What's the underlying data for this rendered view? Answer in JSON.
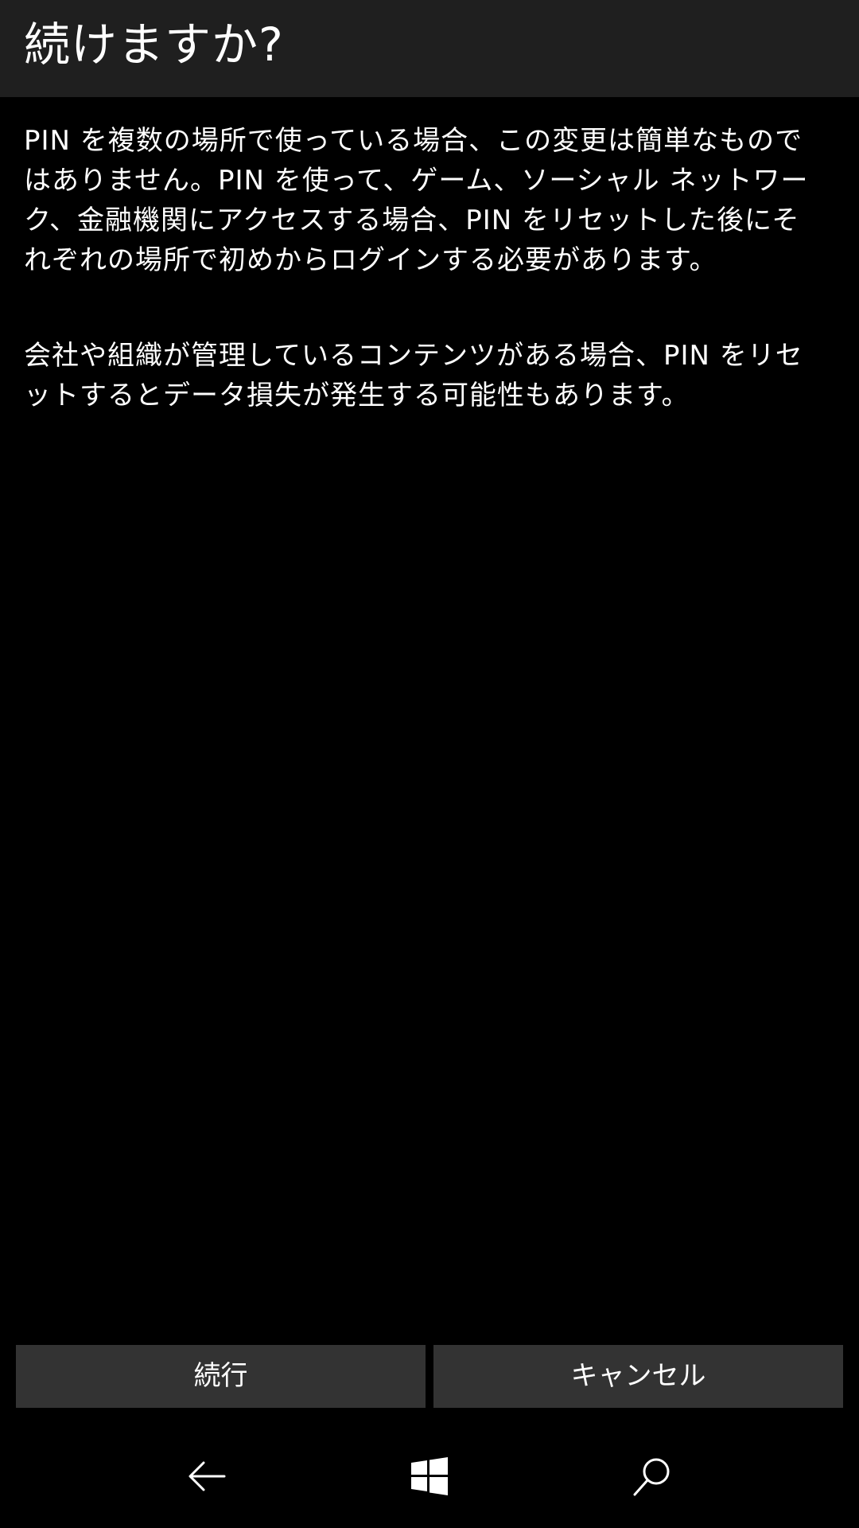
{
  "dialog": {
    "title": "続けますか?",
    "paragraphs": [
      "PIN を複数の場所で使っている場合、この変更は簡単なものではありません。PIN を使って、ゲーム、ソーシャル ネットワーク、金融機関にアクセスする場合、PIN をリセットした後にそれぞれの場所で初めからログインする必要があります。",
      "会社や組織が管理しているコンテンツがある場合、PIN をリセットするとデータ損失が発生する可能性もあります。"
    ],
    "continue_label": "続行",
    "cancel_label": "キャンセル"
  },
  "navbar": {
    "icons": [
      "back-arrow-icon",
      "windows-logo-icon",
      "search-icon"
    ]
  },
  "colors": {
    "background": "#000000",
    "header_background": "#1f1f1f",
    "button_background": "#333333",
    "text": "#ffffff"
  }
}
